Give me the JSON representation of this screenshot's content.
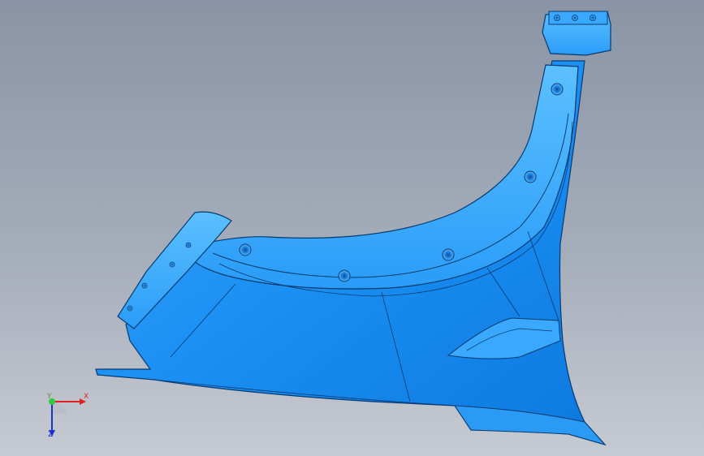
{
  "colors": {
    "part_fill": "#1c8cf0",
    "part_light": "#46b4ff",
    "part_dark": "#0a5fb4",
    "edge": "#073a70",
    "axis_x": "#e02020",
    "axis_y": "#2ecc40",
    "axis_z": "#2030d0"
  },
  "triad": {
    "x_label": "X",
    "y_label": "Y",
    "z_label": "Z"
  },
  "model": {
    "icon": "cad-3d-sheetmetal-part"
  }
}
